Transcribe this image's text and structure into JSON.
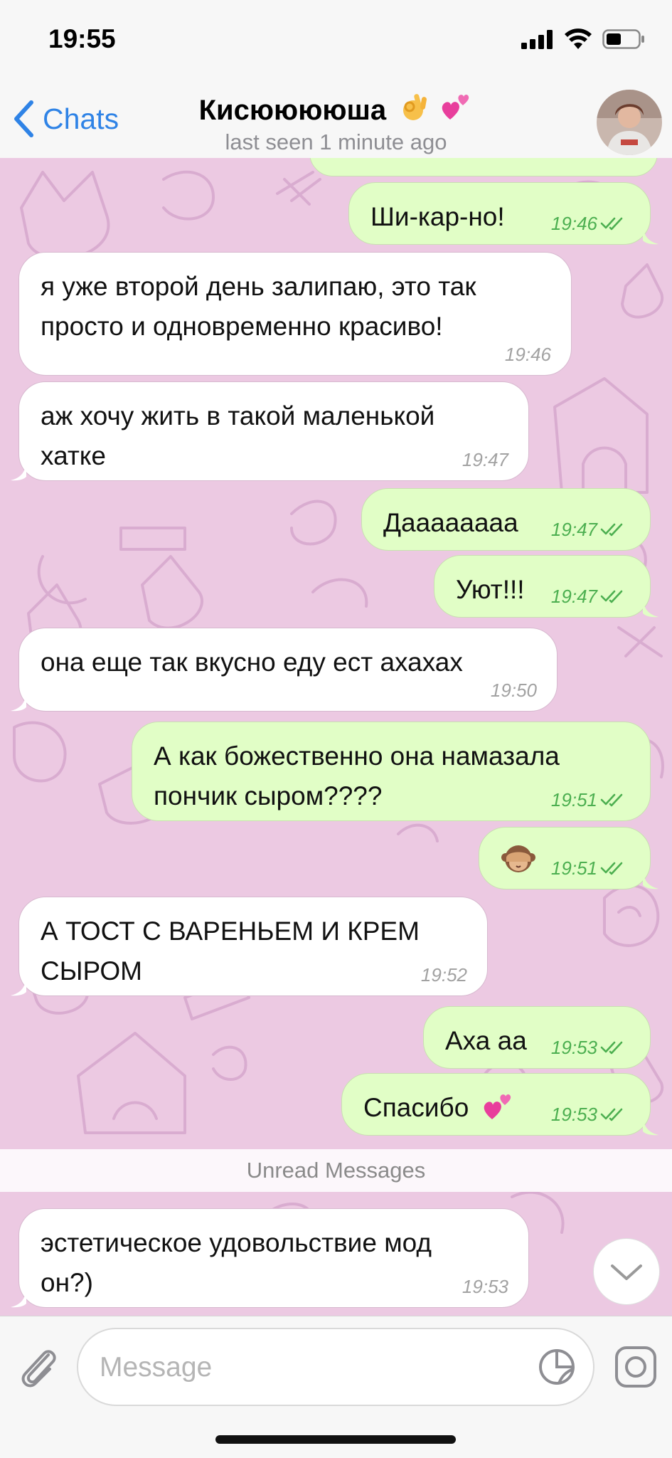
{
  "status": {
    "time": "19:55"
  },
  "header": {
    "back_label": "Chats",
    "title": "Кисююююша",
    "subtitle": "last seen 1 minute ago"
  },
  "messages": [
    {
      "dir": "out",
      "text": "Ши-кар-но!",
      "time": "19:46",
      "read": true
    },
    {
      "dir": "in",
      "text": "я уже второй день залипаю, это так\nпросто и одновременно красиво!",
      "time": "19:46"
    },
    {
      "dir": "in",
      "text": "аж хочу жить в такой маленькой\nхатке",
      "time": "19:47"
    },
    {
      "dir": "out",
      "text": "Даааааааа",
      "time": "19:47",
      "read": true
    },
    {
      "dir": "out",
      "text": "Уют!!!",
      "time": "19:47",
      "read": true
    },
    {
      "dir": "in",
      "text": "она еще так вкусно еду ест ахахах",
      "time": "19:50"
    },
    {
      "dir": "out",
      "text": "А как божественно она намазала\nпончик сыром????",
      "time": "19:51",
      "read": true
    },
    {
      "dir": "out",
      "text": "",
      "time": "19:51",
      "read": true,
      "emoji": "see-no-evil-monkey"
    },
    {
      "dir": "in",
      "text": "А ТОСТ С ВАРЕНЬЕМ И КРЕМ\nСЫРОМ",
      "time": "19:52"
    },
    {
      "dir": "out",
      "text": "Аха аа",
      "time": "19:53",
      "read": true
    },
    {
      "dir": "out",
      "text": "Спасибо",
      "time": "19:53",
      "read": true,
      "emoji": "two-hearts"
    }
  ],
  "unread_label": "Unread Messages",
  "unread_messages": [
    {
      "dir": "in",
      "text": "эстетическое удовольствие мод\nон?)",
      "time": "19:53"
    }
  ],
  "composer": {
    "placeholder": "Message"
  },
  "colors": {
    "accent": "#2f83e6",
    "wallpaper": "#ecc9e2",
    "outgoing_bubble": "#e1fec6",
    "incoming_bubble": "#ffffff",
    "read_check": "#4caf50"
  },
  "icons": {
    "back": "chevron-left-icon",
    "attach": "paperclip-icon",
    "sticker": "sticker-icon",
    "camera": "camera-icon",
    "scroll": "chevron-down-icon"
  }
}
